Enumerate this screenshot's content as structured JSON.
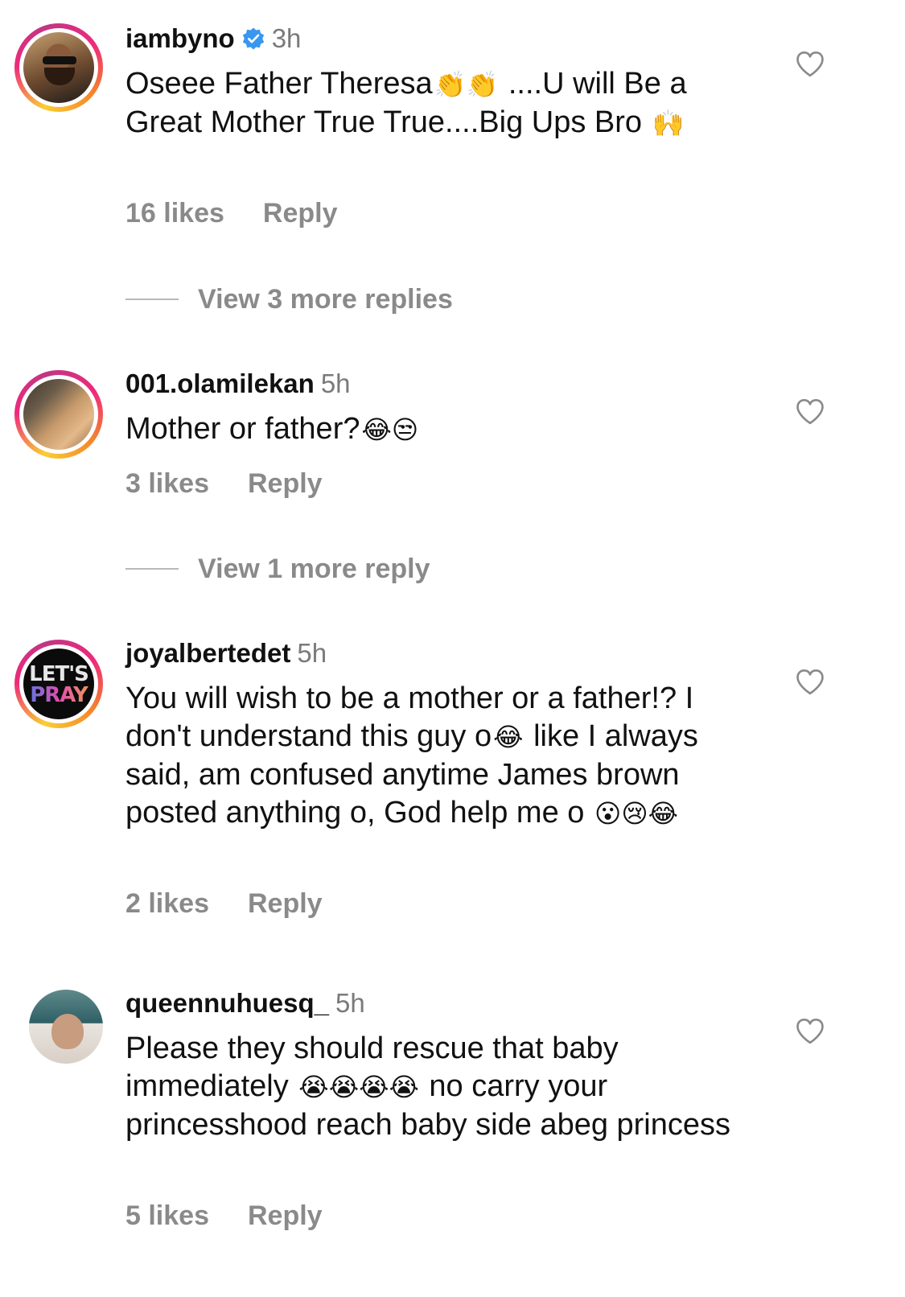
{
  "comments": [
    {
      "username": "iambyno",
      "verified": true,
      "time": "3h",
      "text_parts": [
        "Oseee Father Theresa",
        "👏👏",
        " ....U will Be a Great Mother True True....Big Ups Bro ",
        "🙌"
      ],
      "likes": "16 likes",
      "reply": "Reply",
      "more_replies": "View 3 more replies"
    },
    {
      "username": "001.olamilekan",
      "time": "5h",
      "text_parts": [
        "Mother or father?",
        "😂😒"
      ],
      "likes": "3 likes",
      "reply": "Reply",
      "more_replies": "View 1 more reply"
    },
    {
      "username": "joyalbertedet",
      "time": "5h",
      "avatar_text": [
        "LET'S",
        "PRAY"
      ],
      "text_parts": [
        "You will wish to be a mother or a father!? I don't understand this guy o",
        "😂",
        " like I always said, am confused anytime James brown posted anything o, God help me o ",
        "😮😢😂"
      ],
      "likes": "2 likes",
      "reply": "Reply"
    },
    {
      "username": "queennuhuesq_",
      "time": "5h",
      "text_parts": [
        "Please they should rescue that baby immediately ",
        "😭😭😭😭",
        " no carry your princesshood reach baby side abeg princess"
      ],
      "likes": "5 likes",
      "reply": "Reply"
    }
  ],
  "icons": {
    "like": "heart-outline-icon",
    "verified": "verified-badge-icon"
  },
  "colors": {
    "verified": "#3897f0",
    "muted_text": "#8a8a8a",
    "time_text": "#7a7a7a"
  }
}
